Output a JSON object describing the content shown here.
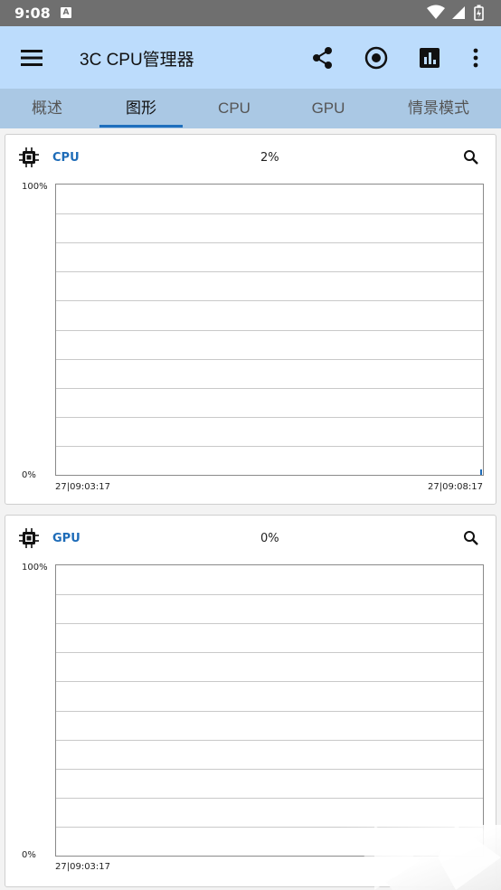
{
  "status_bar": {
    "time": "9:08",
    "notification": "A"
  },
  "app_bar": {
    "title": "3C CPU管理器",
    "icons": [
      "menu-icon",
      "share-icon",
      "record-icon",
      "chart-icon",
      "more-vert-icon"
    ]
  },
  "tabs": [
    {
      "label": "概述",
      "active": false
    },
    {
      "label": "图形",
      "active": true
    },
    {
      "label": "CPU",
      "active": false
    },
    {
      "label": "GPU",
      "active": false
    },
    {
      "label": "情景模式",
      "active": false
    }
  ],
  "colors": {
    "accent": "#1e6cb8",
    "app_bar": "#bcdcfc",
    "tab_bar": "#aac8e4"
  },
  "cards": [
    {
      "title": "CPU",
      "value": "2%",
      "y_max_label": "100%",
      "y_min_label": "0%",
      "x_start_label": "27|09:03:17",
      "x_end_label": "27|09:08:17"
    },
    {
      "title": "GPU",
      "value": "0%",
      "y_max_label": "100%",
      "y_min_label": "0%",
      "x_start_label": "27|09:03:17"
    }
  ],
  "chart_data": [
    {
      "type": "bar",
      "series": [
        {
          "name": "CPU",
          "values": [
            2
          ]
        }
      ],
      "ylim": [
        0,
        100
      ],
      "grid": true
    },
    {
      "type": "line",
      "series": [
        {
          "name": "GPU",
          "values": [
            0
          ]
        }
      ],
      "ylim": [
        0,
        100
      ],
      "grid": true
    }
  ]
}
